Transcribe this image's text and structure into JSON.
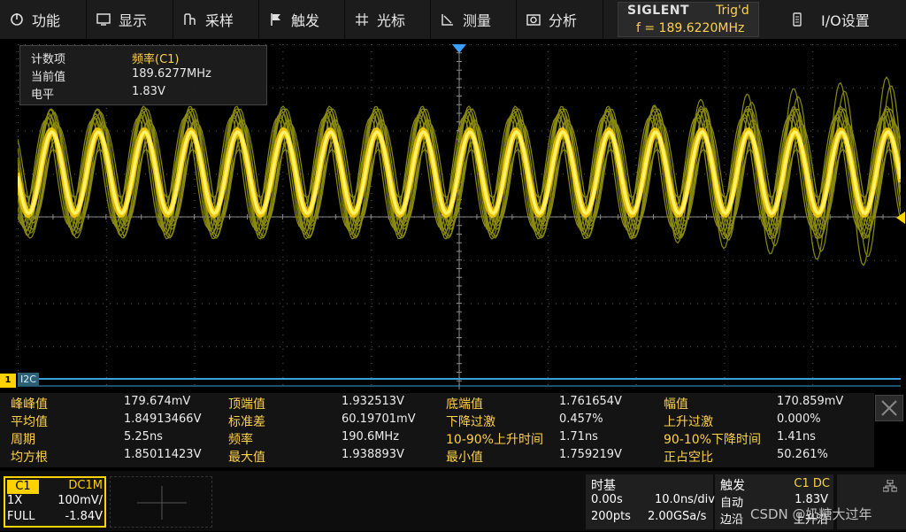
{
  "menu": {
    "function": "功能",
    "display": "显示",
    "acquire": "采样",
    "trigger": "触发",
    "cursor": "光标",
    "measure": "测量",
    "analysis": "分析",
    "io": "I/O设置"
  },
  "status": {
    "brand": "SIGLENT",
    "trig_state": "Trig'd",
    "frequency": "f = 189.6220MHz"
  },
  "popup": {
    "rows": [
      {
        "label": "计数项",
        "value": "频率(C1)"
      },
      {
        "label": "当前值",
        "value": "189.6277MHz"
      },
      {
        "label": "电平",
        "value": "1.83V"
      }
    ]
  },
  "markers": {
    "channel": "1",
    "bus": "I2C"
  },
  "measurements": {
    "rows": [
      [
        {
          "label": "峰峰值",
          "value": "179.674mV"
        },
        {
          "label": "顶端值",
          "value": "1.932513V"
        },
        {
          "label": "底端值",
          "value": "1.761654V"
        },
        {
          "label": "幅值",
          "value": "170.859mV"
        }
      ],
      [
        {
          "label": "平均值",
          "value": "1.84913466V"
        },
        {
          "label": "标准差",
          "value": "60.19701mV"
        },
        {
          "label": "下降过激",
          "value": "0.457%"
        },
        {
          "label": "上升过激",
          "value": "0.000%"
        }
      ],
      [
        {
          "label": "周期",
          "value": "5.25ns"
        },
        {
          "label": "频率",
          "value": "190.6MHz"
        },
        {
          "label": "10-90%上升时间",
          "value": "1.71ns"
        },
        {
          "label": "90-10%下降时间",
          "value": "1.41ns"
        }
      ],
      [
        {
          "label": "均方根",
          "value": "1.85011423V"
        },
        {
          "label": "最大值",
          "value": "1.938893V"
        },
        {
          "label": "最小值",
          "value": "1.759219V"
        },
        {
          "label": "正占空比",
          "value": "50.261%"
        }
      ]
    ]
  },
  "channel1": {
    "name": "C1",
    "coupling": "DC1M",
    "probe": "1X",
    "scale": "100mV/",
    "bandwidth": "FULL",
    "offset": "-1.84V"
  },
  "timebase": {
    "title": "时基",
    "delay": "0.00s",
    "scale": "10.0ns/div",
    "points": "200pts",
    "sample_rate": "2.00GSa/s"
  },
  "trigger": {
    "title": "触发",
    "source": "C1 DC",
    "mode": "自动",
    "level": "1.83V",
    "edge_label": "边沿",
    "slope": "上升沿"
  },
  "watermark": "CSDN @奶糖大过年",
  "colors": {
    "trace": "#ffd200",
    "persistence": "#8a8a10",
    "label": "#ffd24a",
    "bus": "#3aa0d8",
    "grid": "#5a5a5a"
  },
  "icons": [
    "function-icon",
    "display-icon",
    "acquire-icon",
    "trigger-icon",
    "cursor-icon",
    "measure-icon",
    "analysis-icon",
    "io-icon",
    "close-icon",
    "network-icon"
  ]
}
